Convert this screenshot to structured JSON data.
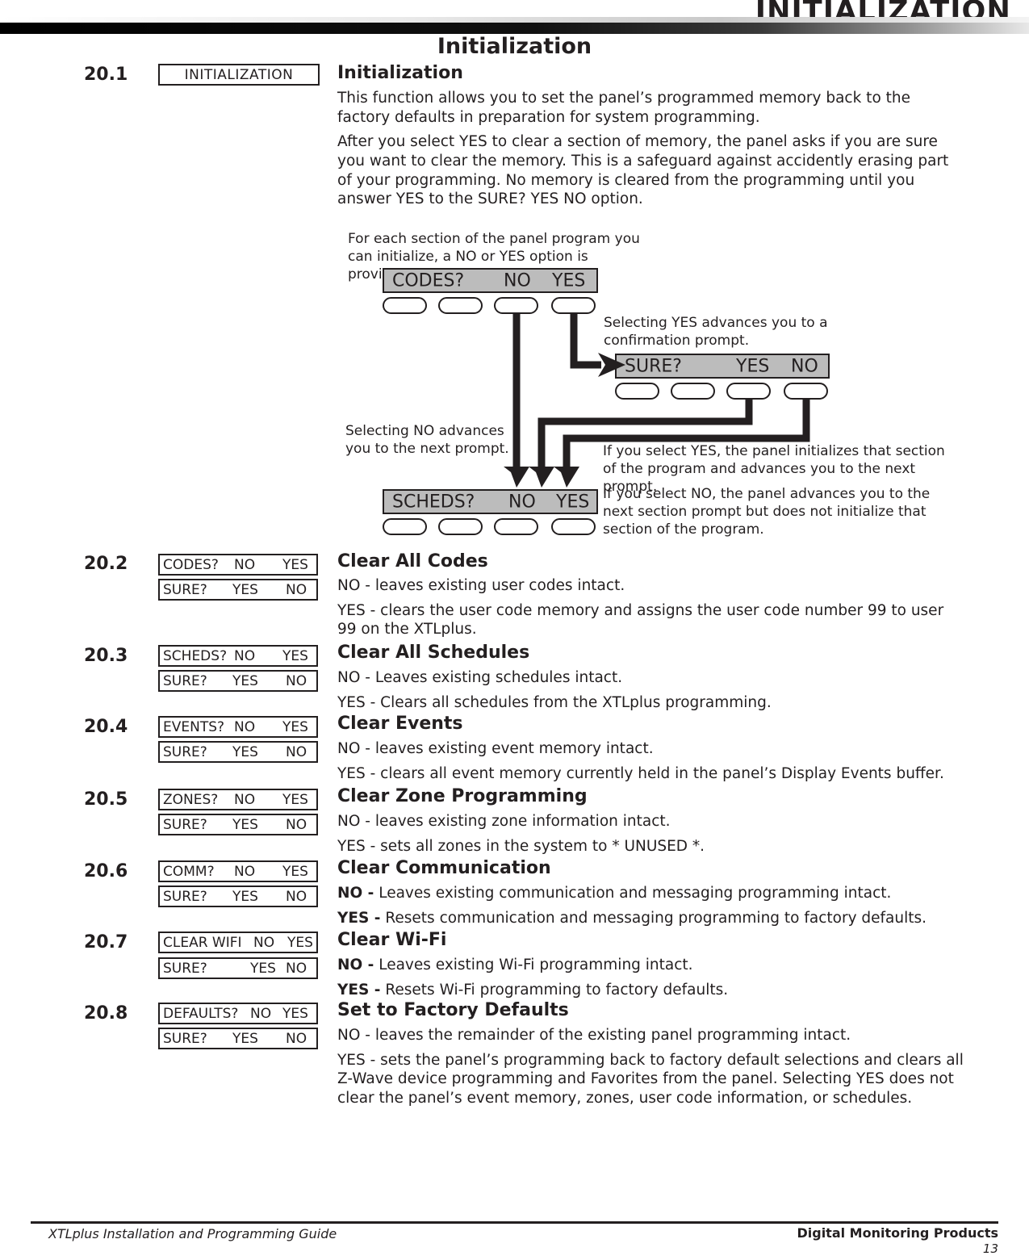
{
  "header": {
    "running_head": "INITIALIZATION",
    "page_title": "Initialization"
  },
  "sections": [
    {
      "number": "20.1",
      "heading": "Initialization",
      "display_label": "INITIALIZATION",
      "paragraphs": [
        "This function allows you to set the panel’s programmed memory back to the factory defaults in preparation for system programming.",
        "After you select YES to clear a section of memory, the panel asks if you are sure you want to clear the memory. This is a safeguard against accidently erasing part of your programming. No memory is cleared from the programming until you answer YES to the SURE?  YES  NO option."
      ]
    },
    {
      "number": "20.2",
      "heading": "Clear All Codes",
      "prompt": {
        "label": "CODES?",
        "no": "NO",
        "yes": "YES"
      },
      "sure": {
        "label": "SURE?",
        "yes": "YES",
        "no": "NO"
      },
      "lines": [
        "NO - leaves existing user codes intact.",
        "YES - clears the user code memory and assigns the user code number 99 to user 99 on the XTLplus."
      ]
    },
    {
      "number": "20.3",
      "heading": "Clear All Schedules",
      "prompt": {
        "label": "SCHEDS?",
        "no": "NO",
        "yes": "YES"
      },
      "sure": {
        "label": "SURE?",
        "yes": "YES",
        "no": "NO"
      },
      "lines": [
        "NO - Leaves existing schedules intact.",
        "YES - Clears all schedules from the XTLplus programming."
      ]
    },
    {
      "number": "20.4",
      "heading": "Clear Events",
      "prompt": {
        "label": "EVENTS?",
        "no": "NO",
        "yes": "YES"
      },
      "sure": {
        "label": "SURE?",
        "yes": "YES",
        "no": "NO"
      },
      "lines": [
        "NO - leaves existing event memory intact.",
        "YES - clears all event memory currently held in the panel’s Display Events buffer."
      ]
    },
    {
      "number": "20.5",
      "heading": "Clear Zone Programming",
      "prompt": {
        "label": "ZONES?",
        "no": "NO",
        "yes": "YES"
      },
      "sure": {
        "label": "SURE?",
        "yes": "YES",
        "no": "NO"
      },
      "lines": [
        "NO - leaves existing zone information intact.",
        "YES - sets all zones in the system to * UNUSED *."
      ]
    },
    {
      "number": "20.6",
      "heading": "Clear Communication",
      "prompt": {
        "label": "COMM?",
        "no": "NO",
        "yes": "YES"
      },
      "sure": {
        "label": "SURE?",
        "yes": "YES",
        "no": "NO"
      },
      "lines_bold_prefix": [
        {
          "prefix": "NO -",
          "rest": " Leaves existing communication and messaging programming intact."
        },
        {
          "prefix": "YES -",
          "rest": " Resets communication and messaging programming to factory defaults."
        }
      ]
    },
    {
      "number": "20.7",
      "heading": "Clear Wi-Fi",
      "prompt": {
        "label": "CLEAR WIFI",
        "no": "NO",
        "yes": "YES"
      },
      "sure": {
        "label": "SURE?",
        "yes": "YES",
        "no": "NO"
      },
      "lines_bold_prefix": [
        {
          "prefix": "NO -",
          "rest": " Leaves existing Wi-Fi programming intact."
        },
        {
          "prefix": "YES -",
          "rest": " Resets Wi-Fi programming to factory defaults."
        }
      ]
    },
    {
      "number": "20.8",
      "heading": "Set to Factory Defaults",
      "prompt": {
        "label": "DEFAULTS?",
        "no": "NO",
        "yes": "YES"
      },
      "sure": {
        "label": "SURE?",
        "yes": "YES",
        "no": "NO"
      },
      "lines": [
        "NO - leaves the remainder of the existing panel programming intact.",
        "YES - sets the panel’s programming back to factory default selections and clears all Z-Wave device programming and Favorites from the panel. Selecting YES does not clear the panel’s event memory, zones, user code information, or schedules."
      ]
    }
  ],
  "diagram": {
    "note_top": "For each section of the panel program you can initialize, a NO or YES option is provided.",
    "note_yes": "Selecting YES advances you to a confirmation prompt.",
    "note_no": "Selecting NO advances you to the next prompt.",
    "note_yes_result": "If you select YES, the panel initializes that section of the program and advances you to the next prompt.",
    "note_no_result": "If you select NO, the panel advances you to the next section prompt but does not initialize that section of the program.",
    "lcd_codes": {
      "label": "CODES?",
      "no": "NO",
      "yes": "YES"
    },
    "lcd_sure": {
      "label": "SURE?",
      "yes": "YES",
      "no": "NO"
    },
    "lcd_scheds": {
      "label": "SCHEDS?",
      "no": "NO",
      "yes": "YES"
    },
    "lcd_fill_color": "#bcbcbc"
  },
  "footer": {
    "left": "XTLplus Installation and Programming Guide",
    "right": "Digital Monitoring Products",
    "page_number": "13"
  }
}
